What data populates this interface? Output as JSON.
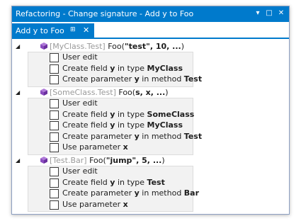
{
  "window": {
    "title": "Refactoring - Change signature - Add y to Foo",
    "dropdown_glyph": "▾",
    "maximize_glyph": "□",
    "close_glyph": "✕"
  },
  "tab": {
    "label": "Add y to Foo",
    "pin_glyph": "⊞",
    "close_glyph": "✕"
  },
  "groups": [
    {
      "expander": "◢",
      "class_name": "[MyClass.Test]",
      "method": "Foo(",
      "args": "\"test\", 10, ...",
      "close": ")",
      "options": [
        {
          "pre": "User edit",
          "b1": "",
          "mid": "",
          "b2": "",
          "checked": false
        },
        {
          "pre": "Create field ",
          "b1": "y",
          "mid": " in type ",
          "b2": "MyClass",
          "checked": false
        },
        {
          "pre": "Create parameter ",
          "b1": "y",
          "mid": " in method ",
          "b2": "Test",
          "checked": false
        }
      ]
    },
    {
      "expander": "◢",
      "class_name": "[SomeClass.Test]",
      "method": "Foo(",
      "args": "s, x, ...",
      "close": ")",
      "options": [
        {
          "pre": "User edit",
          "b1": "",
          "mid": "",
          "b2": "",
          "checked": false
        },
        {
          "pre": "Create field ",
          "b1": "y",
          "mid": " in type ",
          "b2": "SomeClass",
          "checked": false
        },
        {
          "pre": "Create field ",
          "b1": "y",
          "mid": " in type ",
          "b2": "MyClass",
          "checked": false
        },
        {
          "pre": "Create parameter ",
          "b1": "y",
          "mid": " in method ",
          "b2": "Test",
          "checked": false
        },
        {
          "pre": "Use parameter ",
          "b1": "x",
          "mid": "",
          "b2": "",
          "checked": false
        }
      ]
    },
    {
      "expander": "◢",
      "class_name": "[Test.Bar]",
      "method": "Foo(",
      "args": "\"jump\", 5, ...",
      "close": ")",
      "options": [
        {
          "pre": "User edit",
          "b1": "",
          "mid": "",
          "b2": "",
          "checked": false
        },
        {
          "pre": "Create field ",
          "b1": "y",
          "mid": " in type ",
          "b2": "Test",
          "checked": false
        },
        {
          "pre": "Create parameter ",
          "b1": "y",
          "mid": " in method ",
          "b2": "Bar",
          "checked": false
        },
        {
          "pre": "Use parameter ",
          "b1": "x",
          "mid": "",
          "b2": "",
          "checked": false
        }
      ]
    }
  ],
  "colors": {
    "accent": "#007acc",
    "cube": "#8a4bbf",
    "muted_text": "#9a9a9a"
  },
  "icons": {
    "method": "cube-icon",
    "expander": "expander-triangle-icon",
    "checkbox": "checkbox-icon"
  }
}
